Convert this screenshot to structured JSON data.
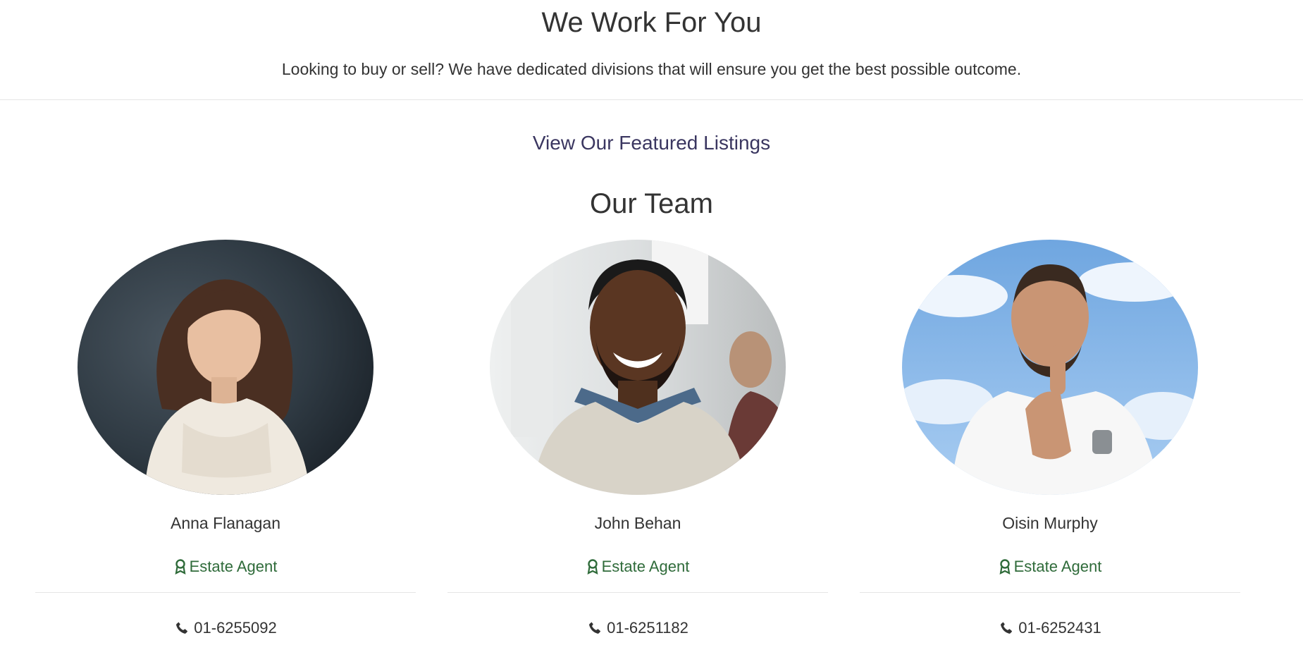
{
  "hero": {
    "title": "We Work For You",
    "subtitle": "Looking to buy or sell? We have dedicated divisions that will ensure you get the best possible outcome."
  },
  "featured": {
    "link_label": "View Our Featured Listings"
  },
  "team": {
    "title": "Our Team",
    "members": [
      {
        "name": "Anna Flanagan",
        "role": "Estate Agent",
        "phone": "01-6255092",
        "role_icon": "award-icon",
        "phone_icon": "phone-icon"
      },
      {
        "name": "John Behan",
        "role": "Estate Agent",
        "phone": "01-6251182",
        "role_icon": "award-icon",
        "phone_icon": "phone-icon"
      },
      {
        "name": "Oisin Murphy",
        "role": "Estate Agent",
        "phone": "01-6252431",
        "role_icon": "award-icon",
        "phone_icon": "phone-icon"
      }
    ]
  },
  "colors": {
    "text": "#333333",
    "link": "#3a3660",
    "role": "#2f6b3a",
    "divider": "#e5e5e5"
  }
}
